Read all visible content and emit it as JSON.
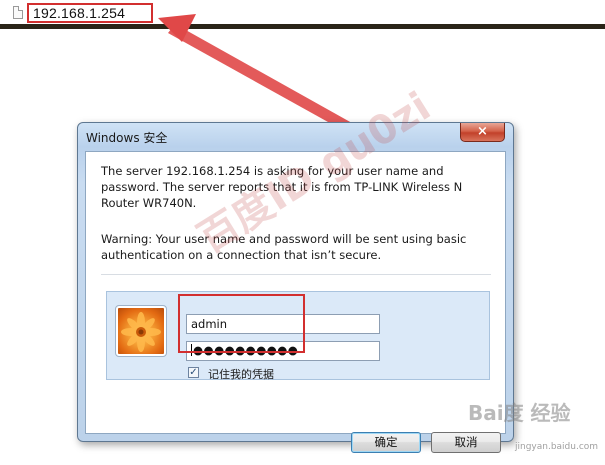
{
  "browser": {
    "address": "192.168.1.254",
    "page_icon": "blank-page-icon"
  },
  "dialog": {
    "title": "Windows 安全",
    "close_icon": "×",
    "message": "The server 192.168.1.254 is asking for your user name and password. The server reports that it is from TP-LINK Wireless N Router WR740N.",
    "warning": "Warning: Your user name and password will be sent using basic authentication on a connection that isn’t secure.",
    "username_value": "admin",
    "password_mask": "●●●●●●●●●●",
    "remember_label": "记住我的凭据",
    "remember_checked": true,
    "ok_label": "确定",
    "cancel_label": "取消"
  },
  "watermark": {
    "text": "百度ID gu0zi",
    "brand": "Bai度 经验",
    "brand_sub": "jingyan.baidu.com"
  },
  "colors": {
    "annotation_red": "#d22f2f",
    "dialog_frame": "#b9d1ec"
  }
}
